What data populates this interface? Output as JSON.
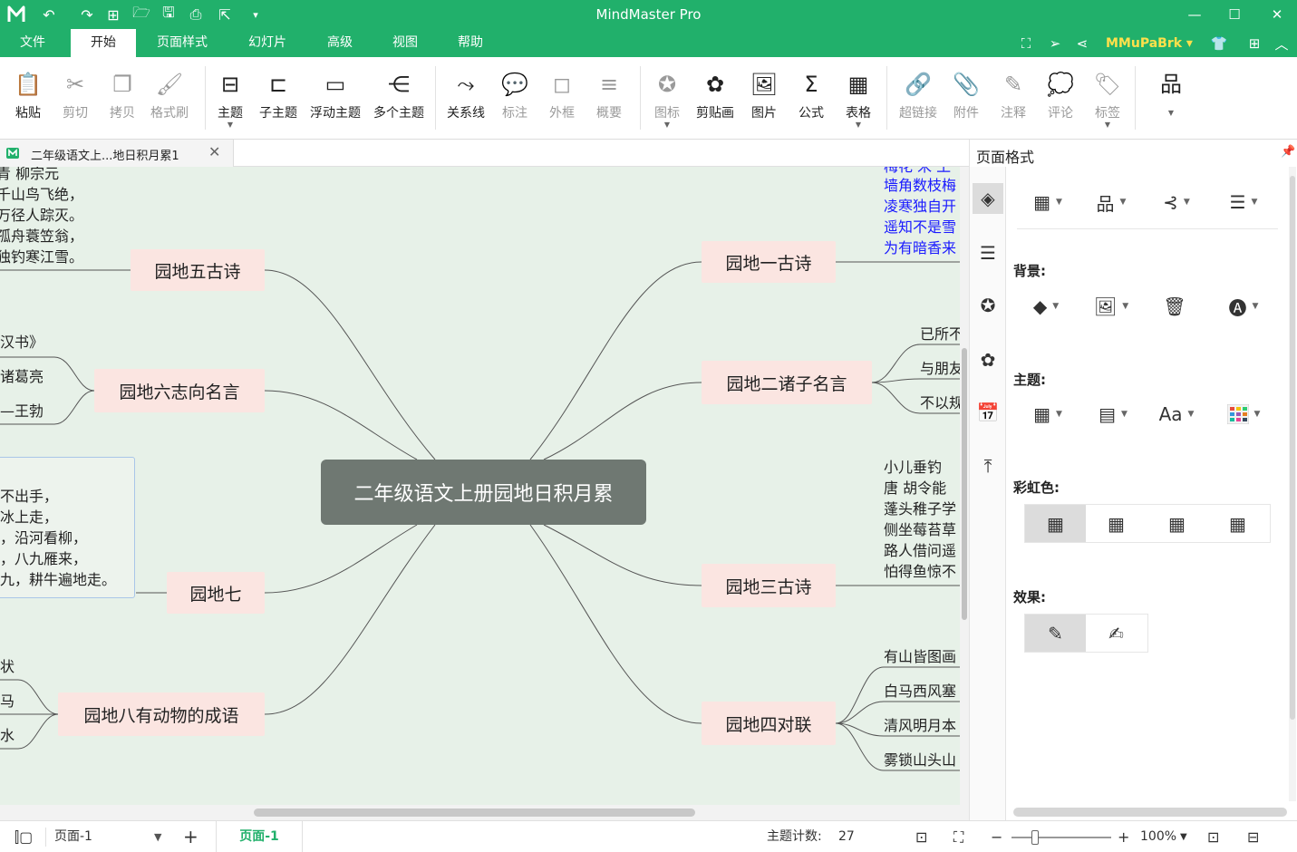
{
  "app": {
    "title": "MindMaster Pro",
    "quick_access": [
      "logo-icon",
      "undo-icon",
      "redo-icon",
      "new-icon",
      "open-icon",
      "save-icon",
      "print-icon",
      "export-icon",
      "customize-icon"
    ],
    "window_controls": [
      "minimize-icon",
      "maximize-icon",
      "close-icon"
    ]
  },
  "menu": {
    "items": [
      "文件",
      "开始",
      "页面样式",
      "幻灯片",
      "高级",
      "视图",
      "帮助"
    ],
    "active": "开始",
    "user": "MMuPaBrk",
    "right_icons": [
      "fullscreen-icon",
      "send-icon",
      "share-icon",
      "skin-icon",
      "apps-icon",
      "collapse-ribbon-icon"
    ]
  },
  "ribbon": [
    {
      "label": "粘贴",
      "icon": "paste-icon",
      "glyph": "📋",
      "enabled": true
    },
    {
      "label": "剪切",
      "icon": "cut-icon",
      "glyph": "✂",
      "enabled": false
    },
    {
      "label": "拷贝",
      "icon": "copy-icon",
      "glyph": "❐",
      "enabled": false
    },
    {
      "label": "格式刷",
      "icon": "format-brush-icon",
      "glyph": "🖌",
      "enabled": false
    },
    {
      "label": "主题",
      "icon": "topic-icon",
      "glyph": "⊟",
      "enabled": true
    },
    {
      "label": "子主题",
      "icon": "subtopic-icon",
      "glyph": "⊏",
      "enabled": true
    },
    {
      "label": "浮动主题",
      "icon": "floating-topic-icon",
      "glyph": "▭",
      "enabled": true
    },
    {
      "label": "多个主题",
      "icon": "multiple-topics-icon",
      "glyph": "⋲",
      "enabled": true
    },
    {
      "label": "关系线",
      "icon": "relationship-icon",
      "glyph": "⤳",
      "enabled": true
    },
    {
      "label": "标注",
      "icon": "callout-icon",
      "glyph": "💬",
      "enabled": false
    },
    {
      "label": "外框",
      "icon": "boundary-icon",
      "glyph": "◻",
      "enabled": false
    },
    {
      "label": "概要",
      "icon": "summary-icon",
      "glyph": "≡",
      "enabled": false
    },
    {
      "label": "图标",
      "icon": "mark-icon",
      "glyph": "✪",
      "enabled": false
    },
    {
      "label": "剪贴画",
      "icon": "clipart-icon",
      "glyph": "✿",
      "enabled": true
    },
    {
      "label": "图片",
      "icon": "picture-icon",
      "glyph": "🖼",
      "enabled": true
    },
    {
      "label": "公式",
      "icon": "formula-icon",
      "glyph": "Σ",
      "enabled": true
    },
    {
      "label": "表格",
      "icon": "table-icon",
      "glyph": "▦",
      "enabled": true
    },
    {
      "label": "超链接",
      "icon": "hyperlink-icon",
      "glyph": "🔗",
      "enabled": false
    },
    {
      "label": "附件",
      "icon": "attachment-icon",
      "glyph": "📎",
      "enabled": false
    },
    {
      "label": "注释",
      "icon": "note-icon",
      "glyph": "✎",
      "enabled": false
    },
    {
      "label": "评论",
      "icon": "comment-icon",
      "glyph": "💭",
      "enabled": false
    },
    {
      "label": "标签",
      "icon": "tag-icon",
      "glyph": "🏷",
      "enabled": false
    }
  ],
  "doc_tab": {
    "name": "二年级语文上...地日积月累1"
  },
  "mindmap": {
    "central": "二年级语文上册园地日积月累",
    "topics": {
      "t1": "园地一古诗",
      "t2": "园地二诸子名言",
      "t3": "园地三古诗",
      "t4": "园地四对联",
      "t5": "园地五古诗",
      "t6": "园地六志向名言",
      "t7": "园地七",
      "t8": "园地八有动物的成语"
    },
    "t1_sub": [
      "梅花  宋 王",
      "墙角数枝梅",
      "凌寒独自开",
      "遥知不是雪",
      "为有暗香来"
    ],
    "t2_sub": [
      "已所不",
      "与朋友",
      "不以规"
    ],
    "t3_sub": [
      "小儿垂钓",
      "唐 胡令能",
      "蓬头稚子学",
      "侧坐莓苔草",
      "路人借问遥",
      "怕得鱼惊不"
    ],
    "t4_sub": [
      "有山皆图画",
      "白马西风塞",
      "清风明月本",
      "雾锁山头山"
    ],
    "t5_sub": [
      "青 柳宗元",
      "千山鸟飞绝，",
      "万径人踪灭。",
      "孤舟蓑笠翁，",
      "独钓寒江雪。"
    ],
    "t6_sub": [
      "汉书》",
      "诸葛亮",
      "—王勃"
    ],
    "t7_sub": [
      "不出手，",
      "冰上走，",
      "，沿河看柳，",
      "，八九雁来，",
      "九，耕牛遍地走。"
    ],
    "t8_sub": [
      "状",
      "马",
      "水"
    ]
  },
  "panel": {
    "title": "页面格式",
    "pin": "pin-icon",
    "vertical_tabs": [
      "page-format-icon",
      "outline-icon",
      "mark-panel-icon",
      "clipart-panel-icon",
      "task-icon",
      "export-panel-icon"
    ],
    "sections": {
      "background": "背景:",
      "theme": "主题:",
      "rainbow": "彩虹色:",
      "effect": "效果:"
    }
  },
  "status": {
    "page_select": "页面-1",
    "page_tab": "页面-1",
    "topic_count_label": "主题计数:",
    "topic_count": "27",
    "zoom": "100%"
  },
  "colors": {
    "brand": "#21b06b",
    "canvas": "#e7f1e8",
    "topic": "#fbe5e1",
    "central": "#6f7872",
    "user": "#ffe04b"
  }
}
